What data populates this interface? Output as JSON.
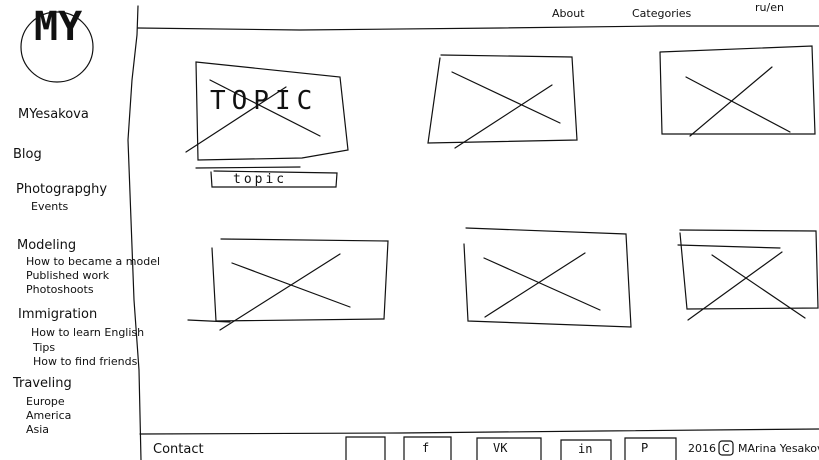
{
  "brand": {
    "logo_letters": "MY",
    "name": "MYesakova"
  },
  "topnav": {
    "about": "About",
    "categories": "Categories",
    "lang": "ru/en"
  },
  "sidebar": {
    "blog": "Blog",
    "photography": {
      "label": "Photograpghy",
      "items": [
        "Events"
      ]
    },
    "modeling": {
      "label": "Modeling",
      "items": [
        "How to became a model",
        "Published work",
        "Photoshoots"
      ]
    },
    "immigration": {
      "label": "Immigration",
      "items": [
        "How to learn English",
        "Tips",
        "How to find friends"
      ]
    },
    "traveling": {
      "label": "Traveling",
      "items": [
        "Europe",
        "America",
        "Asia"
      ]
    }
  },
  "grid": {
    "topic_big": "TOPIC",
    "topic_caption": "topic"
  },
  "footer": {
    "contact": "Contact",
    "social": [
      "f",
      "VK",
      "in",
      "P"
    ],
    "year": "2016",
    "copyright_symbol": "C",
    "author": "MArina Yesakova"
  }
}
